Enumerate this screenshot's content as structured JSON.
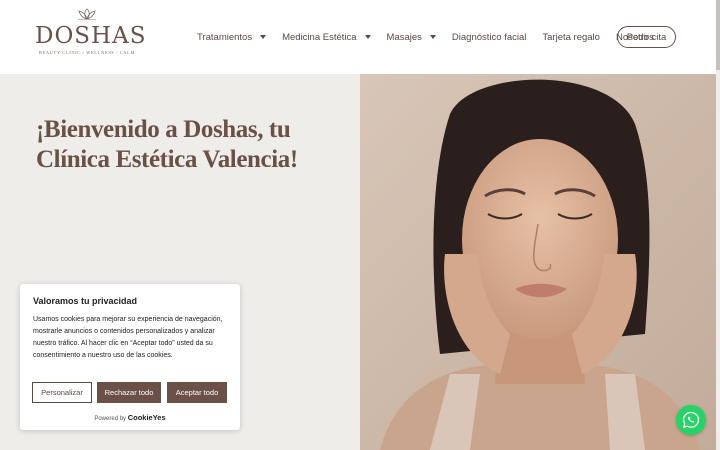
{
  "brand": {
    "name": "DOSHAS",
    "tagline": "BEAUTY CLINIC  /  WELLNESS  /  CALM",
    "color": "#6b5048"
  },
  "nav": {
    "items": [
      {
        "label": "Tratamientos",
        "dropdown": true
      },
      {
        "label": "Medicina Estética",
        "dropdown": true
      },
      {
        "label": "Masajes",
        "dropdown": true
      },
      {
        "label": "Diagnóstico facial",
        "dropdown": false
      },
      {
        "label": "Tarjeta regalo",
        "dropdown": false
      },
      {
        "label": "Nosotros",
        "dropdown": false
      }
    ],
    "cta_label": "Pedir cita"
  },
  "hero": {
    "title": "¡Bienvenido a Doshas, tu Clínica Estética Valencia!",
    "image_icon": "woman-face-photo"
  },
  "cookie_banner": {
    "title": "Valoramos tu privacidad",
    "text": "Usamos cookies para mejorar su experiencia de navegación, mostrarle anuncios o contenidos personalizados y analizar nuestro tráfico. Al hacer clic en “Aceptar todo” usted da su consentimiento a nuestro uso de las cookies.",
    "customize_label": "Personalizar",
    "reject_label": "Rechazar todo",
    "accept_label": "Aceptar todo",
    "powered_by": "Powered by",
    "powered_brand": "CookieYes"
  },
  "whatsapp": {
    "icon": "whatsapp-icon",
    "color": "#25d366"
  }
}
